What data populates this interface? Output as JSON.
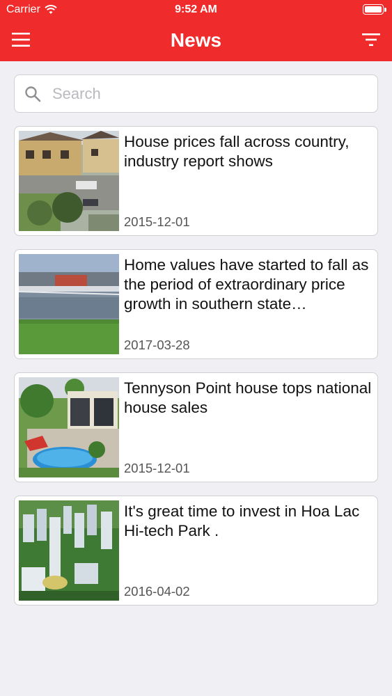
{
  "status_bar": {
    "carrier": "Carrier",
    "time": "9:52 AM"
  },
  "nav": {
    "title": "News",
    "left_icon": "menu-icon",
    "right_icon": "filter-icon"
  },
  "search": {
    "placeholder": "Search",
    "value": ""
  },
  "news": [
    {
      "title": "House prices fall across country, industry report shows",
      "date": "2015-12-01",
      "thumbnail": "suburban-houses"
    },
    {
      "title": "Home values have started to fall as the period of extraordinary price growth in southern state…",
      "date": "2017-03-28",
      "thumbnail": "riverside-stadium"
    },
    {
      "title": "Tennyson Point house tops national house sales",
      "date": "2015-12-01",
      "thumbnail": "house-with-pool"
    },
    {
      "title": "It's great time to invest in Hoa Lac Hi-tech Park .",
      "date": "2016-04-02",
      "thumbnail": "city-towers"
    }
  ],
  "colors": {
    "header": "#ef2b2b",
    "background": "#efeff4",
    "date_text": "#555555"
  }
}
